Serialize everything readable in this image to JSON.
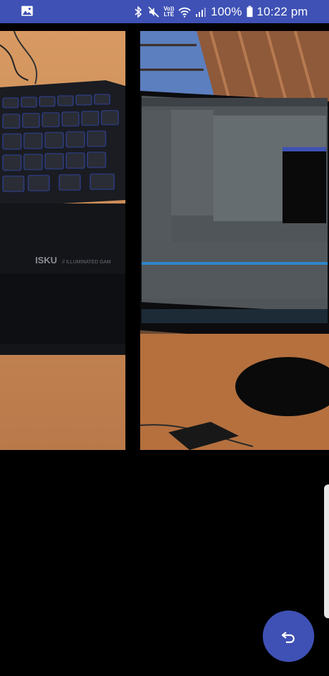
{
  "status_bar": {
    "left_icon": "gallery-icon",
    "icons": [
      "bluetooth-icon",
      "mute-icon",
      "volte-icon",
      "wifi-icon",
      "signal-icon",
      "battery-icon"
    ],
    "volte_label_top": "Vo))",
    "volte_label_bottom": "LTE",
    "battery": "100%",
    "time": "10:22 pm",
    "color": "#3f51b5"
  },
  "photos": [
    {
      "name": "keyboard-photo",
      "keyboard_brand_text": "ISKU",
      "keyboard_tagline": "// ILLUMINATED GAM"
    },
    {
      "name": "monitor-photo"
    }
  ],
  "fab": {
    "icon": "undo-icon",
    "color": "#3f51b5"
  }
}
